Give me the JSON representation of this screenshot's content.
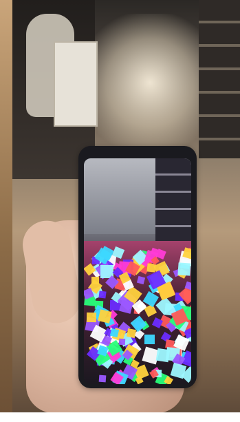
{
  "image": {
    "cube_colors": [
      "#3dd8ff",
      "#ff3bd6",
      "#6b2cff",
      "#28ff7a",
      "#ffd23d",
      "#ff5a5a",
      "#9ef8ff",
      "#9b59ff",
      "#ffffff"
    ]
  }
}
